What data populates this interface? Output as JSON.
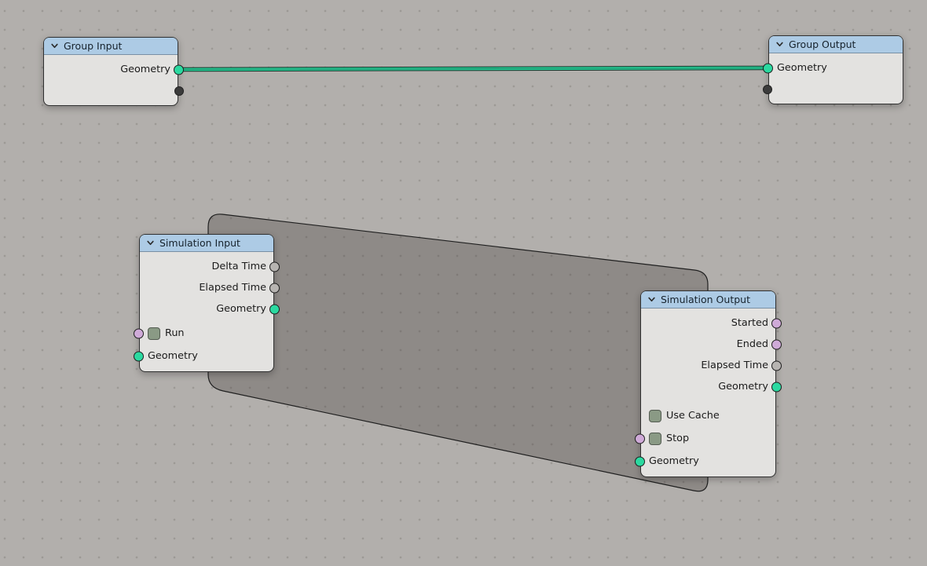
{
  "colors": {
    "background": "#b2afac",
    "grid_dot": "#9c9995",
    "zone_fill": "#8e8b88",
    "zone_outline": "#1f1f1f",
    "node_body": "#e3e2e0",
    "node_header": "#adcbe5",
    "label_text": "#1b1b1b",
    "wire": "#2bd9a0",
    "socket_geometry": "#2bd9a0",
    "socket_boolean": "#cfaad8",
    "socket_float": "#b7b4b1",
    "socket_virtual": "#3b3b3b",
    "checkbox_fill": "#8a9a85"
  },
  "nodes": {
    "group_input": {
      "title": "Group Input",
      "outputs": [
        {
          "label": "Geometry",
          "type": "geometry"
        }
      ]
    },
    "group_output": {
      "title": "Group Output",
      "inputs": [
        {
          "label": "Geometry",
          "type": "geometry"
        }
      ]
    },
    "simulation_input": {
      "title": "Simulation Input",
      "outputs": [
        {
          "label": "Delta Time",
          "type": "float"
        },
        {
          "label": "Elapsed Time",
          "type": "float"
        },
        {
          "label": "Geometry",
          "type": "geometry"
        }
      ],
      "inputs": [
        {
          "label": "Run",
          "type": "boolean",
          "widget": "checkbox"
        },
        {
          "label": "Geometry",
          "type": "geometry"
        }
      ]
    },
    "simulation_output": {
      "title": "Simulation Output",
      "outputs": [
        {
          "label": "Started",
          "type": "boolean"
        },
        {
          "label": "Ended",
          "type": "boolean"
        },
        {
          "label": "Elapsed Time",
          "type": "float"
        },
        {
          "label": "Geometry",
          "type": "geometry"
        }
      ],
      "inputs": [
        {
          "label": "Use Cache",
          "type": "boolean",
          "widget": "checkbox"
        },
        {
          "label": "Stop",
          "type": "boolean",
          "widget": "checkbox"
        },
        {
          "label": "Geometry",
          "type": "geometry"
        }
      ]
    }
  },
  "connections": [
    {
      "from": "Group Input · Geometry",
      "to": "Group Output · Geometry",
      "color": "#2bd9a0"
    }
  ]
}
